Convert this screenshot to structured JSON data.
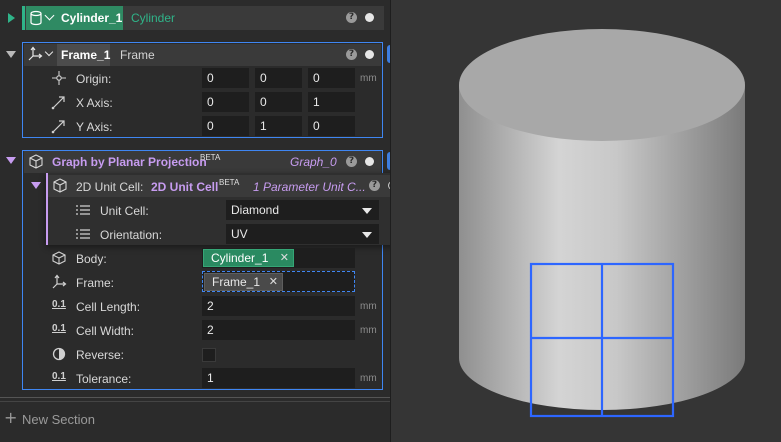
{
  "cylinder": {
    "name": "Cylinder_1",
    "type": "Cylinder",
    "help": "?"
  },
  "frame": {
    "name": "Frame_1",
    "type": "Frame",
    "help": "?",
    "rows": [
      {
        "label": "Origin:",
        "values": [
          "0",
          "0",
          "0"
        ],
        "unit": "mm",
        "icon": "origin-icon"
      },
      {
        "label": "X Axis:",
        "values": [
          "0",
          "0",
          "1"
        ],
        "unit": "",
        "icon": "axis-arrow-icon"
      },
      {
        "label": "Y Axis:",
        "values": [
          "0",
          "1",
          "0"
        ],
        "unit": "",
        "icon": "axis-arrow-icon"
      }
    ]
  },
  "graph": {
    "name": "Graph by Planar Projection",
    "badge": "BETA",
    "output": "Graph_0",
    "help": "?",
    "unit_cell": {
      "label": "2D Unit Cell:",
      "name": "2D Unit Cell",
      "badge": "BETA",
      "output": "1 Parameter Unit C...",
      "help": "?",
      "unit_cell_label": "Unit Cell:",
      "unit_cell_value": "Diamond",
      "orientation_label": "Orientation:",
      "orientation_value": "UV"
    },
    "body_label": "Body:",
    "body_value": "Cylinder_1",
    "frame_label": "Frame:",
    "frame_value": "Frame_1",
    "cell_length_label": "Cell Length:",
    "cell_length_value": "2",
    "cell_length_unit": "mm",
    "cell_width_label": "Cell Width:",
    "cell_width_value": "2",
    "cell_width_unit": "mm",
    "reverse_label": "Reverse:",
    "reverse_checked": false,
    "tolerance_label": "Tolerance:",
    "tolerance_value": "1",
    "tolerance_unit": "mm",
    "numeric_badge": "0.1"
  },
  "new_section": "New Section",
  "remove_glyph": "✕",
  "plus_glyph": "+",
  "colors": {
    "accent": "#3f86f2",
    "green": "#2fb489",
    "purple": "#c79cf0",
    "lattice": "#2d66ff"
  }
}
